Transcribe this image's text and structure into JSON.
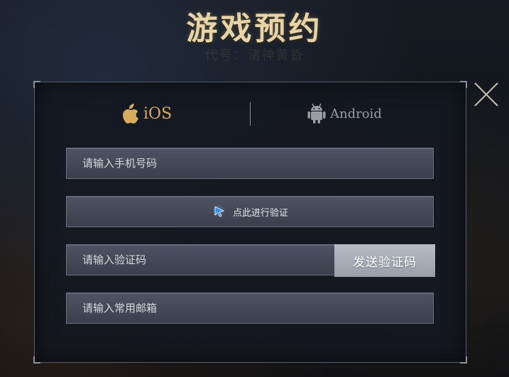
{
  "header": {
    "title": "游戏预约",
    "subtitle": "代号：诸神黄昏"
  },
  "tabs": [
    {
      "label": "iOS",
      "icon": "apple-icon",
      "active": true
    },
    {
      "label": "Android",
      "icon": "android-icon",
      "active": false
    }
  ],
  "form": {
    "phone_placeholder": "请输入手机号码",
    "verify_label": "点此进行验证",
    "code_placeholder": "请输入验证码",
    "send_code_label": "发送验证码",
    "email_placeholder": "请输入常用邮箱"
  },
  "colors": {
    "title": "#e8d4a6",
    "ios_accent": "#d7ac5c",
    "android_inactive": "#9a9da4",
    "field_bg": "#474a58",
    "send_button_bg": "#a9adb8"
  },
  "icons": {
    "close": "close-icon",
    "verify": "cursor-pointer-icon"
  }
}
